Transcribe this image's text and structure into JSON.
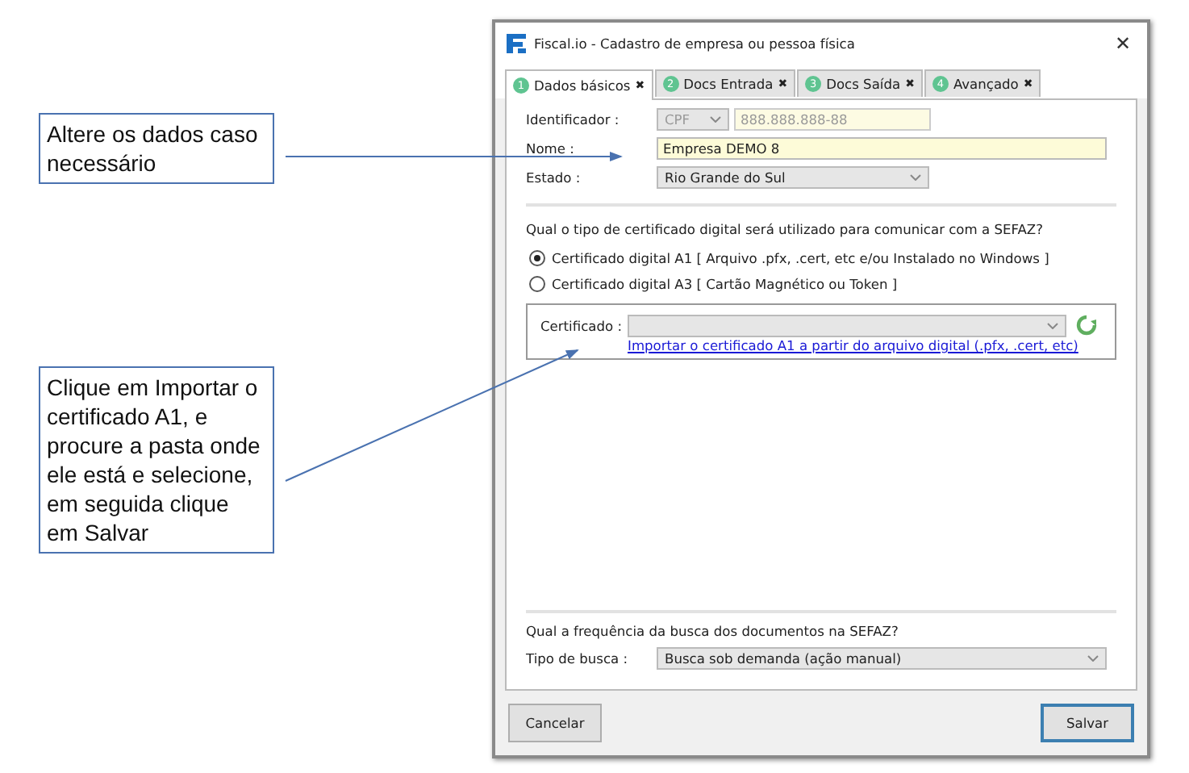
{
  "annotations": [
    {
      "text": "Altere os dados caso necessário"
    },
    {
      "text": "Clique em Importar o certificado A1, e procure a pasta onde ele está e selecione, em seguida clique em Salvar"
    }
  ],
  "window": {
    "title": "Fiscal.io - Cadastro de empresa ou pessoa física",
    "close": "✕"
  },
  "tabs": [
    {
      "number": "1",
      "label": "Dados básicos",
      "close": "✖",
      "selected": true
    },
    {
      "number": "2",
      "label": "Docs Entrada",
      "close": "✖",
      "selected": false
    },
    {
      "number": "3",
      "label": "Docs Saída",
      "close": "✖",
      "selected": false
    },
    {
      "number": "4",
      "label": "Avançado",
      "close": "✖",
      "selected": false
    }
  ],
  "identificador": {
    "label": "Identificador :",
    "type": "CPF",
    "value": "888.888.888-88",
    "disabled": true
  },
  "nome": {
    "label": "Nome :",
    "value": "Empresa DEMO 8"
  },
  "estado": {
    "label": "Estado :",
    "value": "Rio Grande do Sul"
  },
  "certificate_question": "Qual o tipo de certificado digital será utilizado para comunicar com a SEFAZ?",
  "certificate_types": [
    {
      "label": "Certificado digital A1 [ Arquivo .pfx, .cert, etc e/ou Instalado no Windows ]",
      "selected": true
    },
    {
      "label": "Certificado digital A3 [ Cartão Magnético ou Token ]",
      "selected": false
    }
  ],
  "certificado": {
    "label": "Certificado :",
    "import_link": "Importar o certificado A1 a partir do arquivo digital (.pfx, .cert, etc)"
  },
  "frequency_question": "Qual a frequência da busca dos documentos na SEFAZ?",
  "tipo_de_busca": {
    "label": "Tipo de busca :",
    "value": "Busca sob demanda (ação manual)"
  },
  "buttons": [
    {
      "label": "Cancelar",
      "selected": false
    },
    {
      "label": "Salvar",
      "selected": true
    }
  ]
}
